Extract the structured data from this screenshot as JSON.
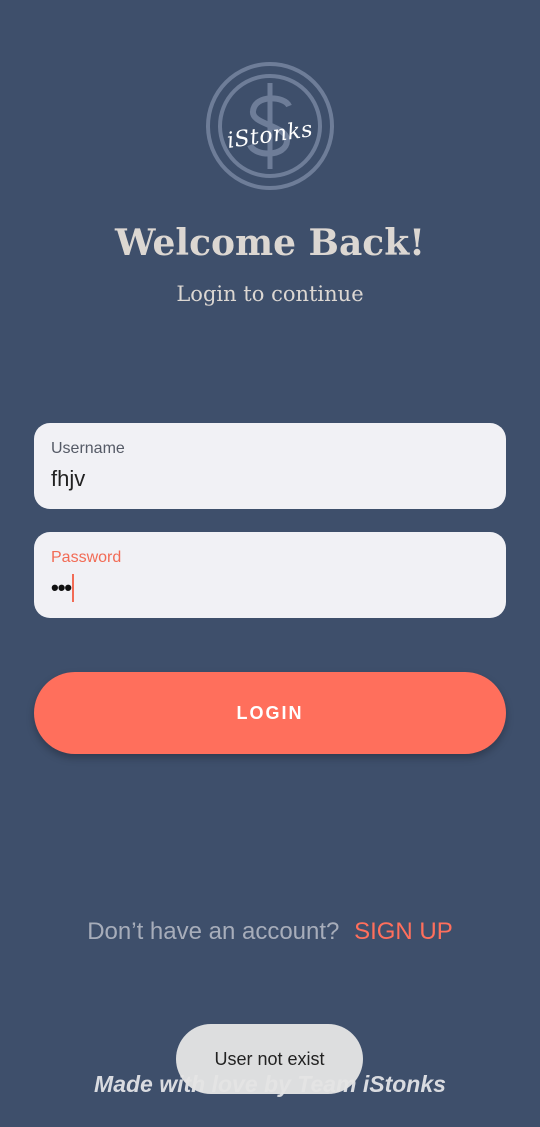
{
  "app": {
    "logo_text": "iStonks"
  },
  "header": {
    "title": "Welcome Back!",
    "subtitle": "Login to continue"
  },
  "form": {
    "username_label": "Username",
    "username_value": "fhjv",
    "password_label": "Password",
    "password_masked": "•••",
    "login_label": "LOGIN"
  },
  "signup": {
    "prompt": "Don’t have an account?",
    "link": "SIGN UP"
  },
  "footer": {
    "text": "Made with love by Team iStonks"
  },
  "toast": {
    "message": "User not exist"
  },
  "colors": {
    "background": "#3e4f6b",
    "accent": "#ff6f5c",
    "field_bg": "#f1f1f5",
    "heading": "#dcd7d2"
  }
}
